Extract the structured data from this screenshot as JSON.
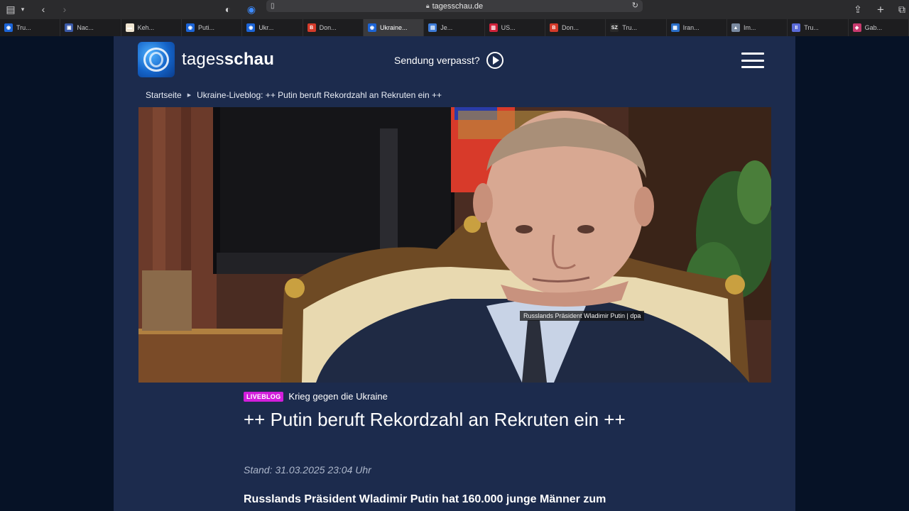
{
  "browser": {
    "url": "tagesschau.de",
    "tabs": [
      {
        "label": "Tru...",
        "color": "#1c64d6",
        "glyph": "◉",
        "active": false
      },
      {
        "label": "Nac...",
        "color": "#3b5aa8",
        "glyph": "▣",
        "active": false
      },
      {
        "label": "Keh...",
        "color": "#f0e6d2",
        "glyph": "▬",
        "active": false
      },
      {
        "label": "Puti...",
        "color": "#1c64d6",
        "glyph": "◉",
        "active": false
      },
      {
        "label": "Ukr...",
        "color": "#1c64d6",
        "glyph": "◉",
        "active": false
      },
      {
        "label": "Don...",
        "color": "#d43a2a",
        "glyph": "B",
        "active": false
      },
      {
        "label": "Ukraine...",
        "color": "#1c64d6",
        "glyph": "◉",
        "active": true
      },
      {
        "label": "Je...",
        "color": "#3e7bd6",
        "glyph": "▤",
        "active": false
      },
      {
        "label": "US...",
        "color": "#d0223a",
        "glyph": "▥",
        "active": false
      },
      {
        "label": "Don...",
        "color": "#d43a2a",
        "glyph": "B",
        "active": false
      },
      {
        "label": "Tru...",
        "color": "#2a2a2a",
        "glyph": "SZ",
        "active": false
      },
      {
        "label": "Iran...",
        "color": "#2a6ec8",
        "glyph": "▦",
        "active": false
      },
      {
        "label": "Im...",
        "color": "#7a8aa0",
        "glyph": "▲",
        "active": false
      },
      {
        "label": "Tru...",
        "color": "#5a6ad8",
        "glyph": "II",
        "active": false
      },
      {
        "label": "Gab...",
        "color": "#c93a6e",
        "glyph": "◈",
        "active": false
      }
    ]
  },
  "site": {
    "logo_plain": "tages",
    "logo_bold": "schau",
    "sendung_label": "Sendung verpasst?",
    "breadcrumb_home": "Startseite",
    "breadcrumb_current": "Ukraine-Liveblog: ++ Putin beruft Rekordzahl an Rekruten ein ++"
  },
  "article": {
    "image_caption": "Russlands Präsident Wladimir Putin | dpa",
    "badge": "LIVEBLOG",
    "topic": "Krieg gegen die Ukraine",
    "headline": "++ Putin beruft Rekordzahl an Rekruten ein ++",
    "stand": "Stand: 31.03.2025 23:04 Uhr",
    "lead": "Russlands Präsident Wladimir Putin hat 160.000 junge Männer zum"
  },
  "colors": {
    "page_bg": "#1c2b4d",
    "side_bg": "#061226",
    "badge": "#d21edc"
  }
}
